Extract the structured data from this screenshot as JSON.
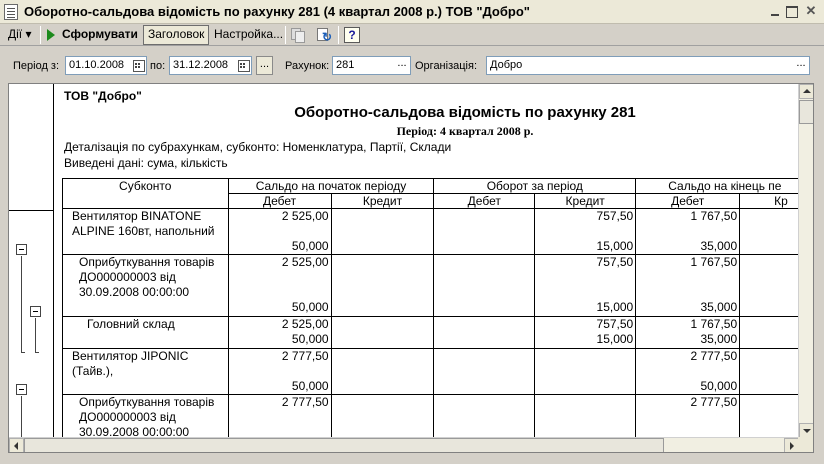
{
  "window": {
    "title": "Оборотно-сальдова відомість по рахунку 281 (4 квартал 2008 р.) ТОВ \"Добро\""
  },
  "toolbar": {
    "actions_label": "Дії",
    "generate_label": "Сформувати",
    "header_label": "Заголовок",
    "settings_label": "Настройка..."
  },
  "params": {
    "period_from_label": "Період з:",
    "period_from_value": "01.10.2008",
    "period_to_label": "по:",
    "period_to_value": "31.12.2008",
    "account_label": "Рахунок:",
    "account_value": "281",
    "org_label": "Організація:",
    "org_value": "Добро",
    "ellipsis": "..."
  },
  "report": {
    "org": "ТОВ \"Добро\"",
    "title": "Оборотно-сальдова відомість по рахунку 281",
    "period": "Період: 4 квартал 2008 р.",
    "detail": "Деталізація по субрахункам, субконто: Номенклатура, Партії, Склади",
    "data": "Виведені дані: сума, кількість",
    "headers": {
      "subconto": "Субконто",
      "opening": "Сальдо на початок періоду",
      "turnover": "Оборот за період",
      "closing": "Сальдо на кінець пе",
      "debit": "Дебет",
      "credit": "Кредит",
      "credit_cut": "Кр"
    },
    "rows": [
      {
        "label": "Вентилятор BINATONE ALPINE 160вт, напольний",
        "ob_d": "2 525,00",
        "ob_d_q": "50,000",
        "tu_c": "757,50",
        "tu_c_q": "15,000",
        "cl_d": "1 767,50",
        "cl_d_q": "35,000"
      },
      {
        "label": "Оприбуткування товарів ДО000000003 від 30.09.2008 00:00:00",
        "ob_d": "2 525,00",
        "ob_d_q": "50,000",
        "tu_c": "757,50",
        "tu_c_q": "15,000",
        "cl_d": "1 767,50",
        "cl_d_q": "35,000"
      },
      {
        "label": "Головний склад",
        "ob_d": "2 525,00",
        "ob_d_q": "50,000",
        "tu_c": "757,50",
        "tu_c_q": "15,000",
        "cl_d": "1 767,50",
        "cl_d_q": "35,000"
      },
      {
        "label": "Вентилятор JIPONIC (Тайв.),",
        "ob_d": "2 777,50",
        "ob_d_q": "50,000",
        "tu_c": "",
        "tu_c_q": "",
        "cl_d": "2 777,50",
        "cl_d_q": "50,000"
      },
      {
        "label": "Оприбуткування товарів ДО000000003 від 30.09.2008 00:00:00",
        "ob_d": "2 777,50",
        "ob_d_q": "",
        "tu_c": "",
        "tu_c_q": "",
        "cl_d": "2 777,50",
        "cl_d_q": ""
      }
    ]
  }
}
